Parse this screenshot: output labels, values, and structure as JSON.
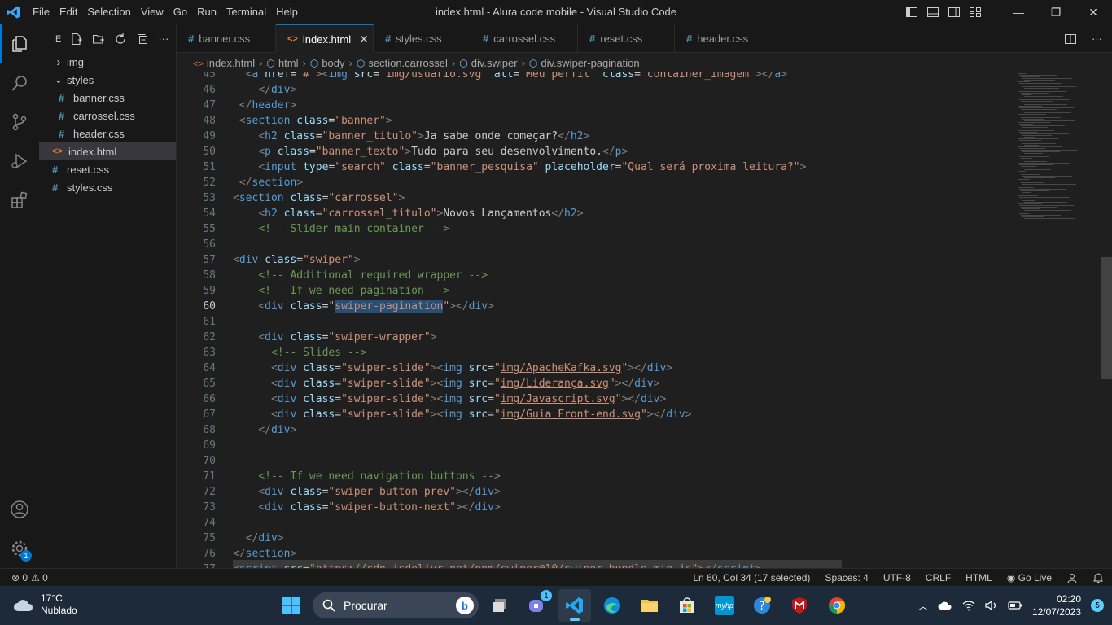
{
  "window": {
    "title": "index.html - Alura code mobile - Visual Studio Code",
    "menu": [
      "File",
      "Edit",
      "Selection",
      "View",
      "Go",
      "Run",
      "Terminal",
      "Help"
    ]
  },
  "activity_bar": {
    "items": [
      "explorer-icon",
      "search-icon",
      "source-control-icon",
      "run-debug-icon",
      "extensions-icon"
    ],
    "bottom": [
      "account-icon",
      "manage-gear-icon"
    ],
    "settings_badge": "1"
  },
  "sidebar": {
    "header": "E",
    "tree": [
      {
        "label": "img",
        "type": "folder",
        "expanded": false,
        "indent": 0
      },
      {
        "label": "styles",
        "type": "folder",
        "expanded": true,
        "indent": 0
      },
      {
        "label": "banner.css",
        "type": "css",
        "indent": 1
      },
      {
        "label": "carrossel.css",
        "type": "css",
        "indent": 1
      },
      {
        "label": "header.css",
        "type": "css",
        "indent": 1
      },
      {
        "label": "index.html",
        "type": "html",
        "indent": 0,
        "selected": true
      },
      {
        "label": "reset.css",
        "type": "css",
        "indent": 0
      },
      {
        "label": "styles.css",
        "type": "css",
        "indent": 0
      }
    ]
  },
  "tabs": [
    {
      "label": "banner.css",
      "type": "css",
      "active": false
    },
    {
      "label": "index.html",
      "type": "html",
      "active": true
    },
    {
      "label": "styles.css",
      "type": "css",
      "active": false
    },
    {
      "label": "carrossel.css",
      "type": "css",
      "active": false
    },
    {
      "label": "reset.css",
      "type": "css",
      "active": false
    },
    {
      "label": "header.css",
      "type": "css",
      "active": false
    }
  ],
  "breadcrumb": [
    "index.html",
    "html",
    "body",
    "section.carrossel",
    "div.swiper",
    "div.swiper-pagination"
  ],
  "editor": {
    "first_line": 45,
    "current_line": 60,
    "lines": [
      [
        [
          "  ",
          "tx"
        ],
        [
          "<",
          "t"
        ],
        [
          "a",
          "tn"
        ],
        [
          " href",
          "at"
        ],
        [
          "=",
          "tx"
        ],
        [
          "\"#\"",
          "av"
        ],
        [
          "><",
          "t"
        ],
        [
          "img",
          "tn"
        ],
        [
          " src",
          "at"
        ],
        [
          "=",
          "tx"
        ],
        [
          "\"img/usuario.svg\"",
          "av"
        ],
        [
          " alt",
          "at"
        ],
        [
          "=",
          "tx"
        ],
        [
          "\"Meu perfil\"",
          "av"
        ],
        [
          " class",
          "at"
        ],
        [
          "=",
          "tx"
        ],
        [
          "\"container_imagem\"",
          "av"
        ],
        [
          "></",
          "t"
        ],
        [
          "a",
          "tn"
        ],
        [
          ">",
          "t"
        ]
      ],
      [
        [
          "    ",
          "tx"
        ],
        [
          "</",
          "t"
        ],
        [
          "div",
          "tn"
        ],
        [
          ">",
          "t"
        ]
      ],
      [
        [
          " ",
          "tx"
        ],
        [
          "</",
          "t"
        ],
        [
          "header",
          "tn"
        ],
        [
          ">",
          "t"
        ]
      ],
      [
        [
          " ",
          "tx"
        ],
        [
          "<",
          "t"
        ],
        [
          "section",
          "tn"
        ],
        [
          " class",
          "at"
        ],
        [
          "=",
          "tx"
        ],
        [
          "\"banner\"",
          "av"
        ],
        [
          ">",
          "t"
        ]
      ],
      [
        [
          "    ",
          "tx"
        ],
        [
          "<",
          "t"
        ],
        [
          "h2",
          "tn"
        ],
        [
          " class",
          "at"
        ],
        [
          "=",
          "tx"
        ],
        [
          "\"banner_titulo\"",
          "av"
        ],
        [
          ">",
          "t"
        ],
        [
          "Ja sabe onde começar?",
          "tx"
        ],
        [
          "</",
          "t"
        ],
        [
          "h2",
          "tn"
        ],
        [
          ">",
          "t"
        ]
      ],
      [
        [
          "    ",
          "tx"
        ],
        [
          "<",
          "t"
        ],
        [
          "p",
          "tn"
        ],
        [
          " class",
          "at"
        ],
        [
          "=",
          "tx"
        ],
        [
          "\"banner_texto\"",
          "av"
        ],
        [
          ">",
          "t"
        ],
        [
          "Tudo para seu desenvolvimento.",
          "tx"
        ],
        [
          "</",
          "t"
        ],
        [
          "p",
          "tn"
        ],
        [
          ">",
          "t"
        ]
      ],
      [
        [
          "    ",
          "tx"
        ],
        [
          "<",
          "t"
        ],
        [
          "input",
          "tn"
        ],
        [
          " type",
          "at"
        ],
        [
          "=",
          "tx"
        ],
        [
          "\"search\"",
          "av"
        ],
        [
          " class",
          "at"
        ],
        [
          "=",
          "tx"
        ],
        [
          "\"banner_pesquisa\"",
          "av"
        ],
        [
          " placeholder",
          "at"
        ],
        [
          "=",
          "tx"
        ],
        [
          "\"Qual será proxima leitura?\"",
          "av"
        ],
        [
          ">",
          "t"
        ]
      ],
      [
        [
          " ",
          "tx"
        ],
        [
          "</",
          "t"
        ],
        [
          "section",
          "tn"
        ],
        [
          ">",
          "t"
        ]
      ],
      [
        [
          "<",
          "t"
        ],
        [
          "section",
          "tn"
        ],
        [
          " class",
          "at"
        ],
        [
          "=",
          "tx"
        ],
        [
          "\"carrossel\"",
          "av"
        ],
        [
          ">",
          "t"
        ]
      ],
      [
        [
          "    ",
          "tx"
        ],
        [
          "<",
          "t"
        ],
        [
          "h2",
          "tn"
        ],
        [
          " class",
          "at"
        ],
        [
          "=",
          "tx"
        ],
        [
          "\"carrossel_titulo\"",
          "av"
        ],
        [
          ">",
          "t"
        ],
        [
          "Novos Lançamentos",
          "tx"
        ],
        [
          "</",
          "t"
        ],
        [
          "h2",
          "tn"
        ],
        [
          ">",
          "t"
        ]
      ],
      [
        [
          "    ",
          "tx"
        ],
        [
          "<!-- Slider main container -->",
          "cm"
        ]
      ],
      [
        [
          "",
          "tx"
        ]
      ],
      [
        [
          "<",
          "t"
        ],
        [
          "div",
          "tn"
        ],
        [
          " class",
          "at"
        ],
        [
          "=",
          "tx"
        ],
        [
          "\"swiper\"",
          "av"
        ],
        [
          ">",
          "t"
        ]
      ],
      [
        [
          "    ",
          "tx"
        ],
        [
          "<!-- Additional required wrapper -->",
          "cm"
        ]
      ],
      [
        [
          "    ",
          "tx"
        ],
        [
          "<!-- If we need pagination -->",
          "cm"
        ]
      ],
      [
        [
          "    ",
          "tx"
        ],
        [
          "<",
          "t"
        ],
        [
          "div",
          "tn"
        ],
        [
          " class",
          "at"
        ],
        [
          "=",
          "tx"
        ],
        [
          "\"",
          "av"
        ],
        [
          "swiper-pagination",
          "av sel"
        ],
        [
          "\"",
          "av"
        ],
        [
          "></",
          "t"
        ],
        [
          "div",
          "tn"
        ],
        [
          ">",
          "t"
        ]
      ],
      [
        [
          "",
          "tx"
        ]
      ],
      [
        [
          "    ",
          "tx"
        ],
        [
          "<",
          "t"
        ],
        [
          "div",
          "tn"
        ],
        [
          " class",
          "at"
        ],
        [
          "=",
          "tx"
        ],
        [
          "\"swiper-wrapper\"",
          "av"
        ],
        [
          ">",
          "t"
        ]
      ],
      [
        [
          "      ",
          "tx"
        ],
        [
          "<!-- Slides -->",
          "cm"
        ]
      ],
      [
        [
          "      ",
          "tx"
        ],
        [
          "<",
          "t"
        ],
        [
          "div",
          "tn"
        ],
        [
          " class",
          "at"
        ],
        [
          "=",
          "tx"
        ],
        [
          "\"swiper-slide\"",
          "av"
        ],
        [
          "><",
          "t"
        ],
        [
          "img",
          "tn"
        ],
        [
          " src",
          "at"
        ],
        [
          "=",
          "tx"
        ],
        [
          "\"",
          "av"
        ],
        [
          "img/ApacheKafka.svg",
          "av u"
        ],
        [
          "\"",
          "av"
        ],
        [
          "></",
          "t"
        ],
        [
          "div",
          "tn"
        ],
        [
          ">",
          "t"
        ]
      ],
      [
        [
          "      ",
          "tx"
        ],
        [
          "<",
          "t"
        ],
        [
          "div",
          "tn"
        ],
        [
          " class",
          "at"
        ],
        [
          "=",
          "tx"
        ],
        [
          "\"swiper-slide\"",
          "av"
        ],
        [
          "><",
          "t"
        ],
        [
          "img",
          "tn"
        ],
        [
          " src",
          "at"
        ],
        [
          "=",
          "tx"
        ],
        [
          "\"",
          "av"
        ],
        [
          "img/Liderança.svg",
          "av u"
        ],
        [
          "\"",
          "av"
        ],
        [
          "></",
          "t"
        ],
        [
          "div",
          "tn"
        ],
        [
          ">",
          "t"
        ]
      ],
      [
        [
          "      ",
          "tx"
        ],
        [
          "<",
          "t"
        ],
        [
          "div",
          "tn"
        ],
        [
          " class",
          "at"
        ],
        [
          "=",
          "tx"
        ],
        [
          "\"swiper-slide\"",
          "av"
        ],
        [
          "><",
          "t"
        ],
        [
          "img",
          "tn"
        ],
        [
          " src",
          "at"
        ],
        [
          "=",
          "tx"
        ],
        [
          "\"",
          "av"
        ],
        [
          "img/Javascript.svg",
          "av u"
        ],
        [
          "\"",
          "av"
        ],
        [
          "></",
          "t"
        ],
        [
          "div",
          "tn"
        ],
        [
          ">",
          "t"
        ]
      ],
      [
        [
          "      ",
          "tx"
        ],
        [
          "<",
          "t"
        ],
        [
          "div",
          "tn"
        ],
        [
          " class",
          "at"
        ],
        [
          "=",
          "tx"
        ],
        [
          "\"swiper-slide\"",
          "av"
        ],
        [
          "><",
          "t"
        ],
        [
          "img",
          "tn"
        ],
        [
          " src",
          "at"
        ],
        [
          "=",
          "tx"
        ],
        [
          "\"",
          "av"
        ],
        [
          "img/Guia Front-end.svg",
          "av u"
        ],
        [
          "\"",
          "av"
        ],
        [
          "></",
          "t"
        ],
        [
          "div",
          "tn"
        ],
        [
          ">",
          "t"
        ]
      ],
      [
        [
          "    ",
          "tx"
        ],
        [
          "</",
          "t"
        ],
        [
          "div",
          "tn"
        ],
        [
          ">",
          "t"
        ]
      ],
      [
        [
          "",
          "tx"
        ]
      ],
      [
        [
          "",
          "tx"
        ]
      ],
      [
        [
          "    ",
          "tx"
        ],
        [
          "<!-- If we need navigation buttons -->",
          "cm"
        ]
      ],
      [
        [
          "    ",
          "tx"
        ],
        [
          "<",
          "t"
        ],
        [
          "div",
          "tn"
        ],
        [
          " class",
          "at"
        ],
        [
          "=",
          "tx"
        ],
        [
          "\"swiper-button-prev\"",
          "av"
        ],
        [
          "></",
          "t"
        ],
        [
          "div",
          "tn"
        ],
        [
          ">",
          "t"
        ]
      ],
      [
        [
          "    ",
          "tx"
        ],
        [
          "<",
          "t"
        ],
        [
          "div",
          "tn"
        ],
        [
          " class",
          "at"
        ],
        [
          "=",
          "tx"
        ],
        [
          "\"swiper-button-next\"",
          "av"
        ],
        [
          "></",
          "t"
        ],
        [
          "div",
          "tn"
        ],
        [
          ">",
          "t"
        ]
      ],
      [
        [
          "",
          "tx"
        ]
      ],
      [
        [
          "  ",
          "tx"
        ],
        [
          "</",
          "t"
        ],
        [
          "div",
          "tn"
        ],
        [
          ">",
          "t"
        ]
      ],
      [
        [
          "</",
          "t"
        ],
        [
          "section",
          "tn"
        ],
        [
          ">",
          "t"
        ]
      ],
      [
        [
          "<",
          "t"
        ],
        [
          "script",
          "tn"
        ],
        [
          " src",
          "at"
        ],
        [
          "=",
          "tx"
        ],
        [
          "\"https://cdn.jsdelivr.net/npm/swiper@10/swiper-bundle.min.js\"",
          "av"
        ],
        [
          "></",
          "t"
        ],
        [
          "script",
          "tn"
        ],
        [
          ">",
          "t"
        ]
      ]
    ]
  },
  "status_bar": {
    "errors": "⊗ 0",
    "warnings": "⚠ 0",
    "position": "Ln 60, Col 34 (17 selected)",
    "spaces": "Spaces: 4",
    "encoding": "UTF-8",
    "eol": "CRLF",
    "language": "HTML",
    "go_live": "Go Live"
  },
  "taskbar": {
    "weather_temp": "17°C",
    "weather_desc": "Nublado",
    "search_placeholder": "Procurar",
    "apps": [
      "task-view-icon",
      "meet-chat-icon",
      "vscode-icon",
      "edge-icon",
      "file-explorer-icon",
      "store-icon",
      "hp-icon",
      "tips-icon",
      "mcafee-icon",
      "chrome-icon"
    ],
    "chat_badge": "1",
    "time": "02:20",
    "date": "12/07/2023",
    "notifications": "5"
  },
  "colors": {
    "accent": "#0078d4",
    "tag": "#569cd6",
    "attribute": "#9cdcfe",
    "string": "#ce9178",
    "comment": "#6a9955"
  }
}
